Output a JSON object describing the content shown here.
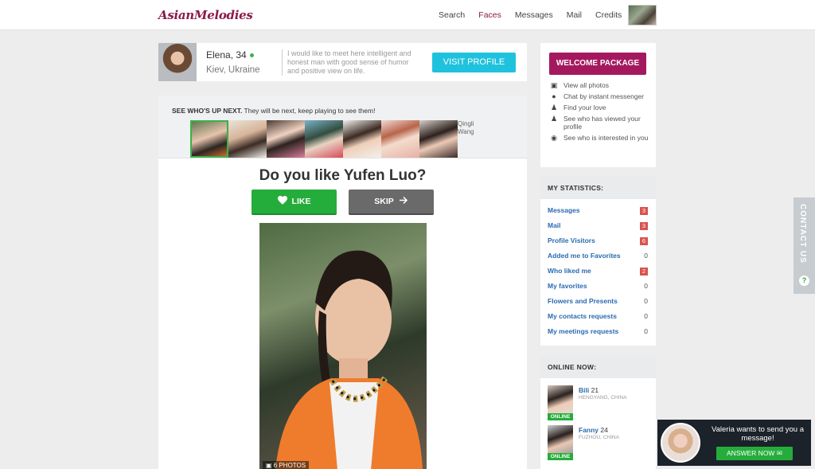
{
  "header": {
    "logo": "AsianMelodies",
    "nav": [
      {
        "label": "Search",
        "active": false
      },
      {
        "label": "Faces",
        "active": true
      },
      {
        "label": "Messages",
        "active": false
      },
      {
        "label": "Mail",
        "active": false
      },
      {
        "label": "Credits",
        "active": false
      }
    ]
  },
  "profile_strip": {
    "name": "Elena, 34",
    "location": "Kiev, Ukraine",
    "about": "I would like to meet here intelligent and honest man with good sense of humor and positive view on life.",
    "visit_label": "VISIT PROFILE"
  },
  "game": {
    "next_bold": "SEE WHO'S UP NEXT.",
    "next_rest": "They will be next, keep playing to see them!",
    "thumb_alt": "Qingli Wang",
    "question": "Do you like Yufen Luo?",
    "like_label": "LIKE",
    "skip_label": "SKIP",
    "photo_count": "6 PHOTOS"
  },
  "welcome": {
    "button": "WELCOME PACKAGE",
    "items": [
      {
        "icon": "camera-icon",
        "label": "View all photos"
      },
      {
        "icon": "chat-icon",
        "label": "Chat by instant messenger"
      },
      {
        "icon": "user-icon",
        "label": "Find your love"
      },
      {
        "icon": "user-icon",
        "label": "See who has viewed your profile"
      },
      {
        "icon": "eye-icon",
        "label": "See who is interested in you"
      }
    ]
  },
  "stats": {
    "title": "MY STATISTICS:",
    "rows": [
      {
        "label": "Messages",
        "value": "3",
        "badge": true
      },
      {
        "label": "Mail",
        "value": "3",
        "badge": true
      },
      {
        "label": "Profile Visitors",
        "value": "6",
        "badge": true
      },
      {
        "label": "Added me to Favorites",
        "value": "0",
        "badge": false
      },
      {
        "label": "Who liked me",
        "value": "2",
        "badge": true
      },
      {
        "label": "My favorites",
        "value": "0",
        "badge": false
      },
      {
        "label": "Flowers and Presents",
        "value": "0",
        "badge": false
      },
      {
        "label": "My contacts requests",
        "value": "0",
        "badge": false
      },
      {
        "label": "My meetings requests",
        "value": "0",
        "badge": false
      }
    ]
  },
  "online": {
    "title": "ONLINE NOW:",
    "badge": "ONLINE",
    "users": [
      {
        "name": "Bili",
        "age": "21",
        "city": "HENGYANG, CHINA"
      },
      {
        "name": "Fanny",
        "age": "24",
        "city": "FUZHOU, CHINA"
      }
    ]
  },
  "contact_tab": "CONTACT US",
  "popup": {
    "text": "Valeria wants to send you a message!",
    "button": "ANSWER NOW"
  },
  "colors": {
    "brand": "#8c1a4a",
    "like": "#25ad3b",
    "visit": "#1fc2dd",
    "welcome": "#a4195e",
    "link": "#2a6bb0"
  }
}
